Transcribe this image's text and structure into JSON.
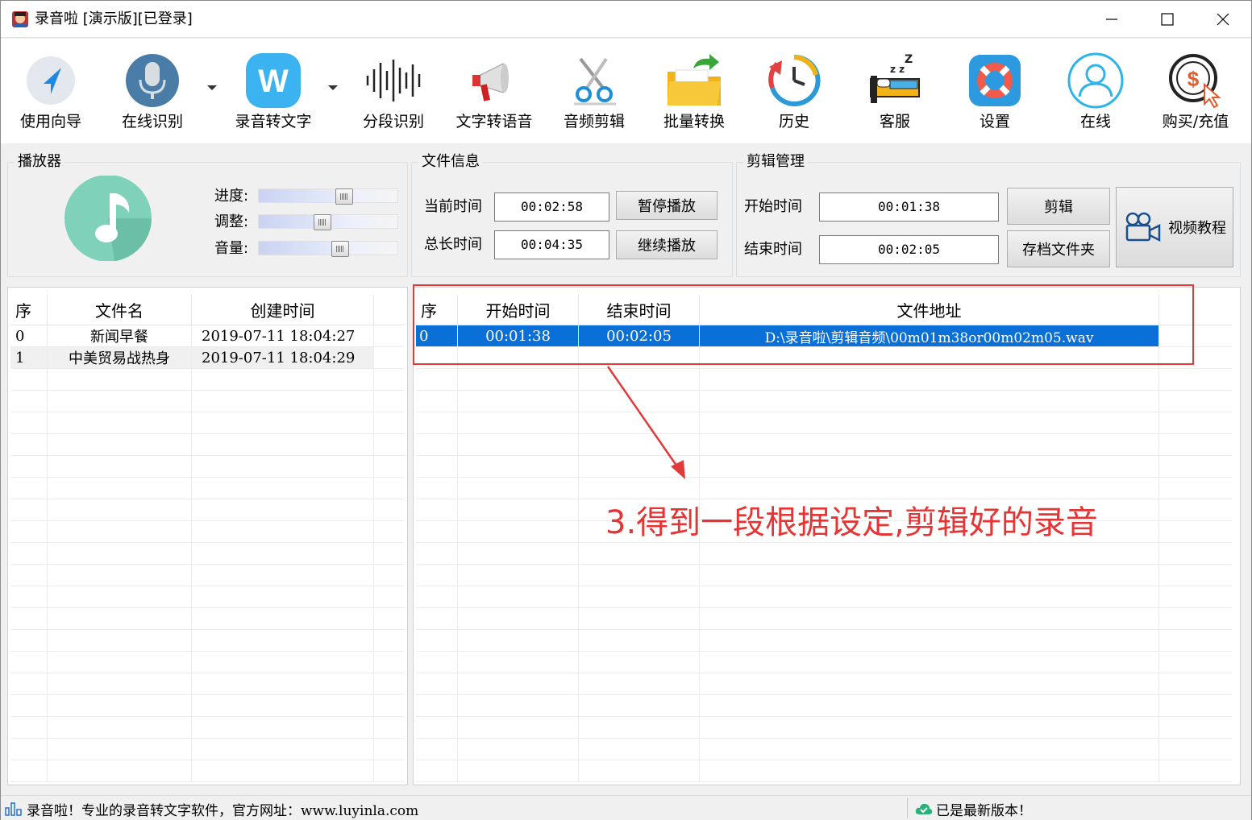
{
  "window": {
    "title": "录音啦 [演示版][已登录]"
  },
  "toolbar": {
    "items": [
      {
        "label": "使用向导",
        "icon": "navigation-arrow-icon"
      },
      {
        "label": "在线识别",
        "icon": "microphone-icon"
      },
      {
        "label": "录音转文字",
        "icon": "w-logo-icon"
      },
      {
        "label": "分段识别",
        "icon": "waveform-icon"
      },
      {
        "label": "文字转语音",
        "icon": "megaphone-icon"
      },
      {
        "label": "音频剪辑",
        "icon": "scissors-icon"
      },
      {
        "label": "批量转换",
        "icon": "folder-arrow-icon"
      },
      {
        "label": "历史",
        "icon": "history-clock-icon"
      },
      {
        "label": "客服",
        "icon": "sleeping-bed-icon"
      },
      {
        "label": "设置",
        "icon": "lifebuoy-icon"
      },
      {
        "label": "在线",
        "icon": "user-circle-icon"
      },
      {
        "label": "购买/充值",
        "icon": "dollar-coin-icon"
      }
    ]
  },
  "player": {
    "title": "播放器",
    "sliders": [
      {
        "label": "进度:",
        "value": 0.63
      },
      {
        "label": "调整:",
        "value": 0.45
      },
      {
        "label": "音量:",
        "value": 0.6
      }
    ]
  },
  "file_info": {
    "title": "文件信息",
    "current_time_label": "当前时间",
    "current_time": "00:02:58",
    "total_time_label": "总长时间",
    "total_time": "00:04:35",
    "pause_button": "暂停播放",
    "resume_button": "继续播放"
  },
  "clip_manager": {
    "title": "剪辑管理",
    "start_label": "开始时间",
    "start_time": "00:01:38",
    "end_label": "结束时间",
    "end_time": "00:02:05",
    "clip_button": "剪辑",
    "archive_button": "存档文件夹",
    "tutorial_button": "视频教程"
  },
  "file_table": {
    "headers": [
      "序",
      "文件名",
      "创建时间"
    ],
    "rows": [
      [
        "0",
        "新闻早餐",
        "2019-07-11 18:04:27"
      ],
      [
        "1",
        "中美贸易战热身",
        "2019-07-11 18:04:29"
      ]
    ]
  },
  "clip_table": {
    "headers": [
      "序",
      "开始时间",
      "结束时间",
      "文件地址"
    ],
    "rows": [
      [
        "0",
        "00:01:38",
        "00:02:05",
        "D:\\录音啦\\剪辑音频\\00m01m38or00m02m05.wav"
      ]
    ]
  },
  "annotation": "3.得到一段根据设定,剪辑好的录音",
  "status": {
    "left": "录音啦！专业的录音转文字软件，官方网址：www.luyinla.com",
    "right": "已是最新版本！"
  },
  "colors": {
    "selection": "#0a6fd6",
    "annotation": "#e63434",
    "accent_teal": "#7fd1b9"
  }
}
